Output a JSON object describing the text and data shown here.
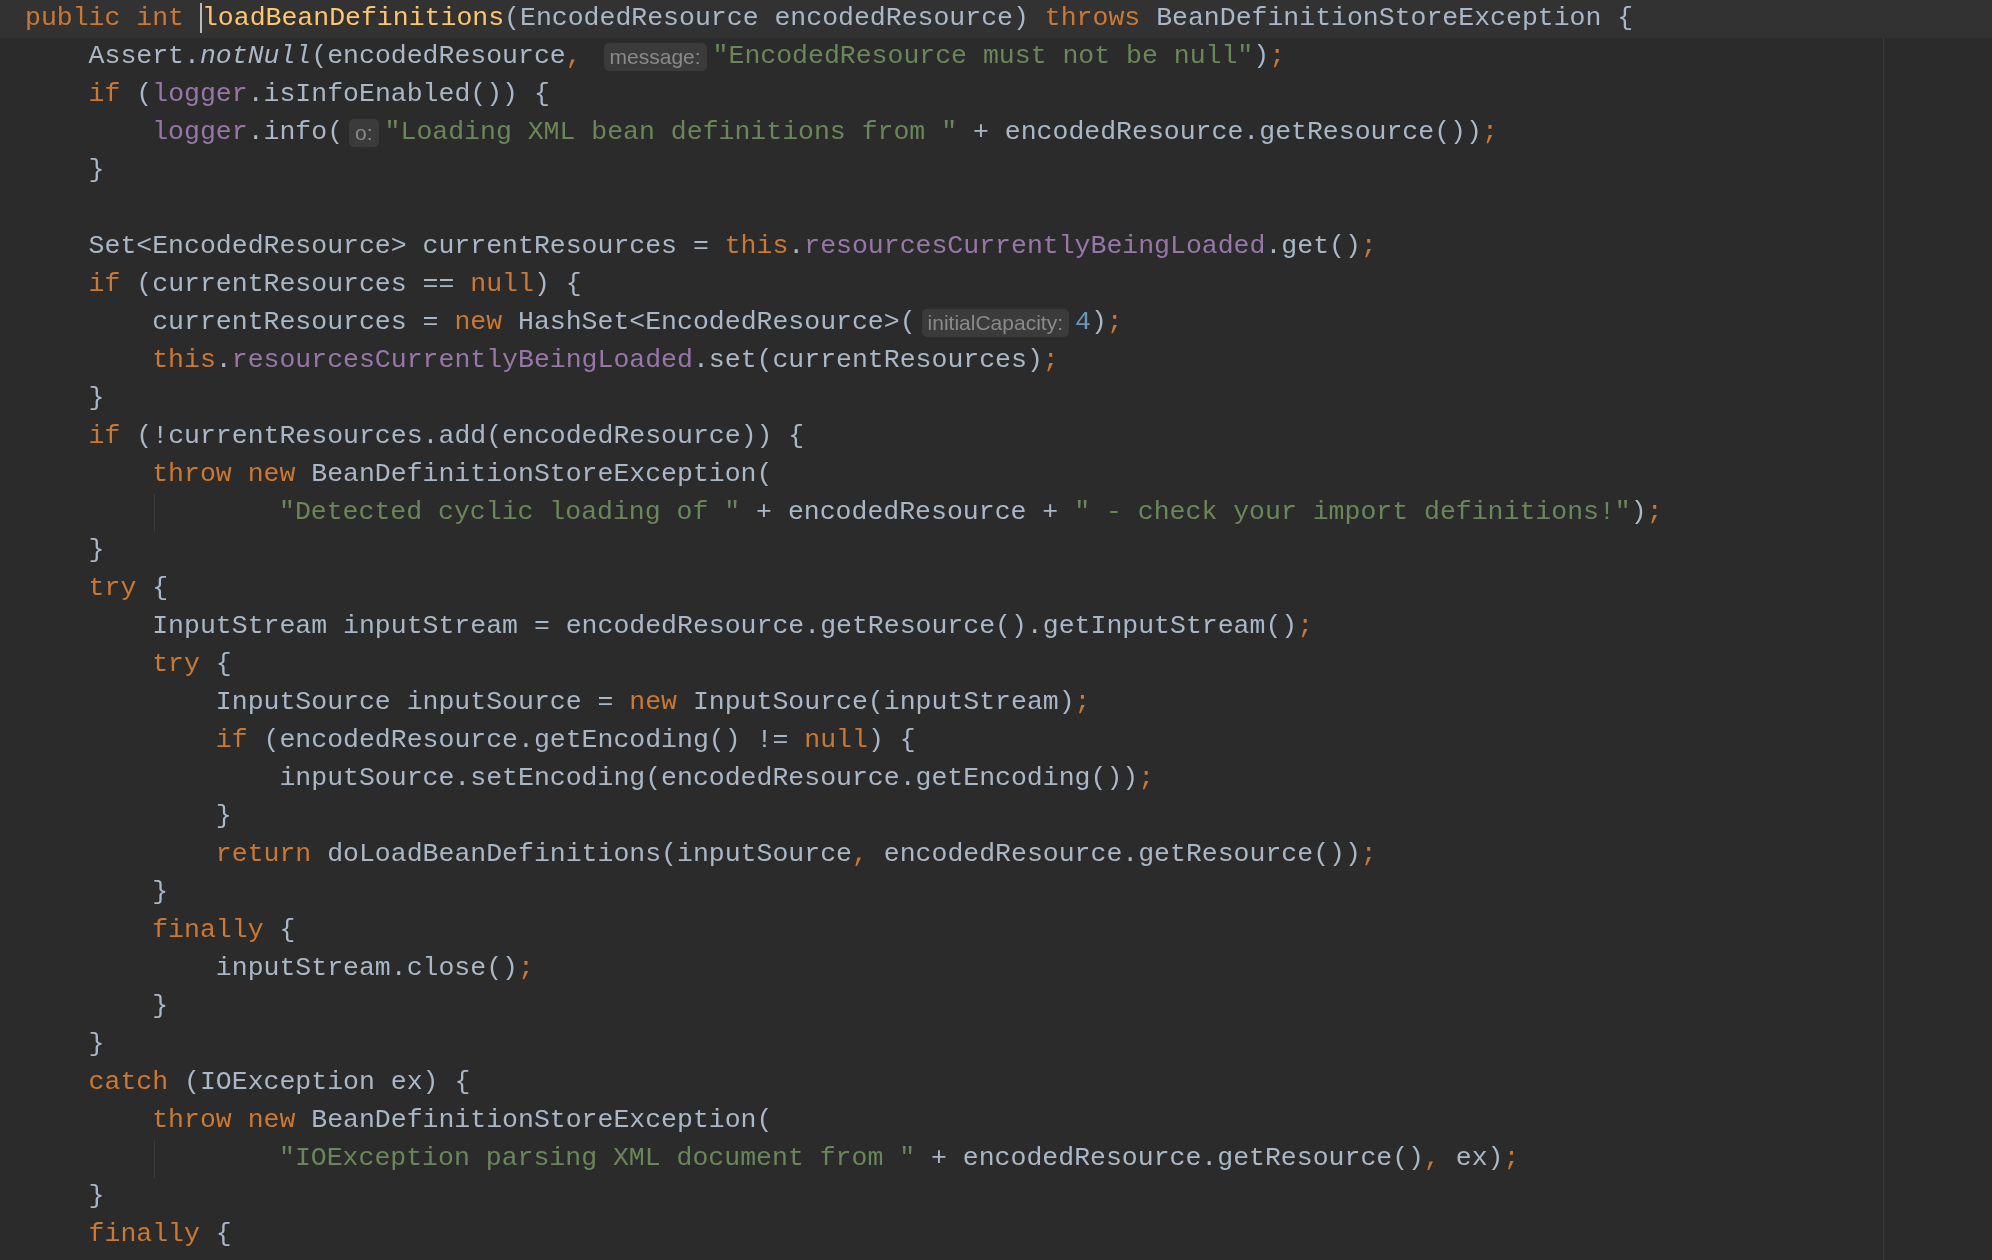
{
  "editor": {
    "lines": [
      {
        "current": true,
        "tokens": [
          {
            "kind": "k",
            "text": "public int "
          },
          {
            "kind": "m",
            "text": "loadBeanDefinitions",
            "caret": true
          },
          {
            "kind": "p",
            "text": "(EncodedResource encodedResource) "
          },
          {
            "kind": "k",
            "text": "throws "
          },
          {
            "kind": "p",
            "text": "BeanDefinitionStoreException {"
          }
        ]
      },
      {
        "tokens": [
          {
            "kind": "p",
            "text": "    Assert."
          },
          {
            "kind": "i",
            "text": "notNull"
          },
          {
            "kind": "p",
            "text": "(encodedResource"
          },
          {
            "kind": "k",
            "text": ", "
          },
          {
            "kind": "h",
            "text": "message:"
          },
          {
            "kind": "s",
            "text": "\"EncodedResource must not be null\""
          },
          {
            "kind": "p",
            "text": ")"
          },
          {
            "kind": "k",
            "text": ";"
          }
        ]
      },
      {
        "tokens": [
          {
            "kind": "k",
            "text": "    if "
          },
          {
            "kind": "p",
            "text": "("
          },
          {
            "kind": "f",
            "text": "logger"
          },
          {
            "kind": "p",
            "text": ".isInfoEnabled()) {"
          }
        ]
      },
      {
        "tokens": [
          {
            "kind": "f",
            "text": "        logger"
          },
          {
            "kind": "p",
            "text": ".info("
          },
          {
            "kind": "h",
            "text": "o:"
          },
          {
            "kind": "s",
            "text": "\"Loading XML bean definitions from \""
          },
          {
            "kind": "p",
            "text": " + encodedResource.getResource())"
          },
          {
            "kind": "k",
            "text": ";"
          }
        ]
      },
      {
        "tokens": [
          {
            "kind": "p",
            "text": "    }"
          }
        ]
      },
      {
        "kind": "blank"
      },
      {
        "tokens": [
          {
            "kind": "p",
            "text": "    Set<EncodedResource> currentResources = "
          },
          {
            "kind": "k",
            "text": "this"
          },
          {
            "kind": "p",
            "text": "."
          },
          {
            "kind": "f",
            "text": "resourcesCurrentlyBeingLoaded"
          },
          {
            "kind": "p",
            "text": ".get()"
          },
          {
            "kind": "k",
            "text": ";"
          }
        ]
      },
      {
        "tokens": [
          {
            "kind": "k",
            "text": "    if "
          },
          {
            "kind": "p",
            "text": "(currentResources == "
          },
          {
            "kind": "k",
            "text": "null"
          },
          {
            "kind": "p",
            "text": ") {"
          }
        ]
      },
      {
        "tokens": [
          {
            "kind": "p",
            "text": "        currentResources = "
          },
          {
            "kind": "k",
            "text": "new "
          },
          {
            "kind": "p",
            "text": "HashSet<EncodedResource>("
          },
          {
            "kind": "h",
            "text": "initialCapacity:"
          },
          {
            "kind": "n",
            "text": "4"
          },
          {
            "kind": "p",
            "text": ")"
          },
          {
            "kind": "k",
            "text": ";"
          }
        ]
      },
      {
        "tokens": [
          {
            "kind": "k",
            "text": "        this"
          },
          {
            "kind": "p",
            "text": "."
          },
          {
            "kind": "f",
            "text": "resourcesCurrentlyBeingLoaded"
          },
          {
            "kind": "p",
            "text": ".set(currentResources)"
          },
          {
            "kind": "k",
            "text": ";"
          }
        ]
      },
      {
        "tokens": [
          {
            "kind": "p",
            "text": "    }"
          }
        ]
      },
      {
        "tokens": [
          {
            "kind": "k",
            "text": "    if "
          },
          {
            "kind": "p",
            "text": "(!currentResources.add(encodedResource)) {"
          }
        ]
      },
      {
        "tokens": [
          {
            "kind": "k",
            "text": "        throw new "
          },
          {
            "kind": "p",
            "text": "BeanDefinitionStoreException("
          }
        ]
      },
      {
        "guide": true,
        "tokens": [
          {
            "kind": "s",
            "text": "\"Detected cyclic loading of \""
          },
          {
            "kind": "p",
            "text": " + encodedResource + "
          },
          {
            "kind": "s",
            "text": "\" - check your import definitions!\""
          },
          {
            "kind": "p",
            "text": ")"
          },
          {
            "kind": "k",
            "text": ";"
          }
        ]
      },
      {
        "tokens": [
          {
            "kind": "p",
            "text": "    }"
          }
        ]
      },
      {
        "tokens": [
          {
            "kind": "k",
            "text": "    try "
          },
          {
            "kind": "p",
            "text": "{"
          }
        ]
      },
      {
        "tokens": [
          {
            "kind": "p",
            "text": "        InputStream inputStream = encodedResource.getResource().getInputStream()"
          },
          {
            "kind": "k",
            "text": ";"
          }
        ]
      },
      {
        "tokens": [
          {
            "kind": "k",
            "text": "        try "
          },
          {
            "kind": "p",
            "text": "{"
          }
        ]
      },
      {
        "tokens": [
          {
            "kind": "p",
            "text": "            InputSource inputSource = "
          },
          {
            "kind": "k",
            "text": "new "
          },
          {
            "kind": "p",
            "text": "InputSource(inputStream)"
          },
          {
            "kind": "k",
            "text": ";"
          }
        ]
      },
      {
        "tokens": [
          {
            "kind": "k",
            "text": "            if "
          },
          {
            "kind": "p",
            "text": "(encodedResource.getEncoding() != "
          },
          {
            "kind": "k",
            "text": "null"
          },
          {
            "kind": "p",
            "text": ") {"
          }
        ]
      },
      {
        "tokens": [
          {
            "kind": "p",
            "text": "                inputSource.setEncoding(encodedResource.getEncoding())"
          },
          {
            "kind": "k",
            "text": ";"
          }
        ]
      },
      {
        "tokens": [
          {
            "kind": "p",
            "text": "            }"
          }
        ]
      },
      {
        "tokens": [
          {
            "kind": "k",
            "text": "            return "
          },
          {
            "kind": "p",
            "text": "doLoadBeanDefinitions(inputSource"
          },
          {
            "kind": "k",
            "text": ", "
          },
          {
            "kind": "p",
            "text": "encodedResource.getResource())"
          },
          {
            "kind": "k",
            "text": ";"
          }
        ]
      },
      {
        "tokens": [
          {
            "kind": "p",
            "text": "        }"
          }
        ]
      },
      {
        "tokens": [
          {
            "kind": "k",
            "text": "        finally "
          },
          {
            "kind": "p",
            "text": "{"
          }
        ]
      },
      {
        "tokens": [
          {
            "kind": "p",
            "text": "            inputStream.close()"
          },
          {
            "kind": "k",
            "text": ";"
          }
        ]
      },
      {
        "tokens": [
          {
            "kind": "p",
            "text": "        }"
          }
        ]
      },
      {
        "tokens": [
          {
            "kind": "p",
            "text": "    }"
          }
        ]
      },
      {
        "tokens": [
          {
            "kind": "k",
            "text": "    catch "
          },
          {
            "kind": "p",
            "text": "(IOException ex) {"
          }
        ]
      },
      {
        "tokens": [
          {
            "kind": "k",
            "text": "        throw new "
          },
          {
            "kind": "p",
            "text": "BeanDefinitionStoreException("
          }
        ]
      },
      {
        "guide": true,
        "tokens": [
          {
            "kind": "s",
            "text": "\"IOException parsing XML document from \""
          },
          {
            "kind": "p",
            "text": " + encodedResource.getResource()"
          },
          {
            "kind": "k",
            "text": ", "
          },
          {
            "kind": "p",
            "text": "ex)"
          },
          {
            "kind": "k",
            "text": ";"
          }
        ]
      },
      {
        "tokens": [
          {
            "kind": "p",
            "text": "    }"
          }
        ]
      },
      {
        "tokens": [
          {
            "kind": "k",
            "text": "    finally "
          },
          {
            "kind": "p",
            "text": "{"
          }
        ]
      }
    ]
  }
}
